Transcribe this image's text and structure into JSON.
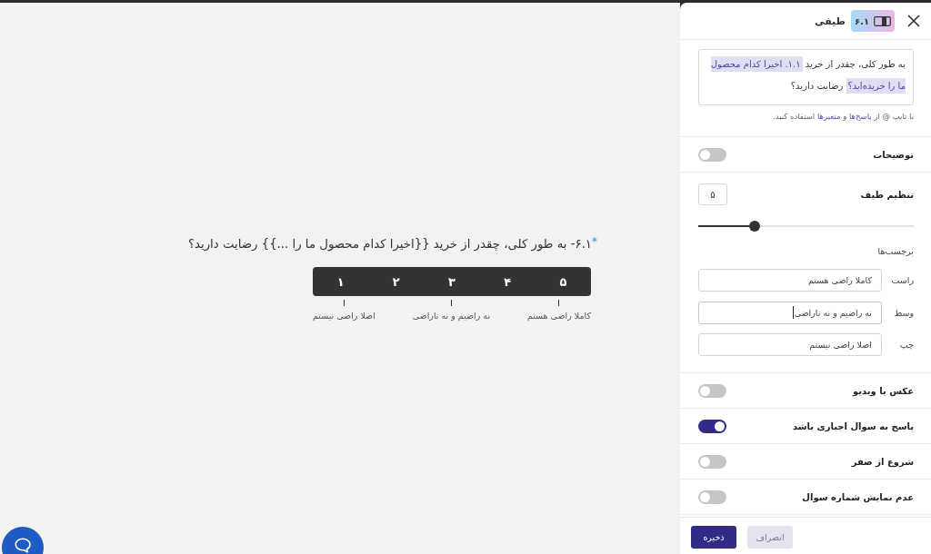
{
  "question": {
    "required_mark": "*",
    "text": "۶.۱- به طور کلی، چقدر از خرید {{اخیرا کدام محصول ما را ...}} رضایت دارید؟",
    "scale": [
      {
        "value": "۵",
        "label": "کاملا راضی هستم"
      },
      {
        "value": "۴"
      },
      {
        "value": "۳",
        "label": "نه راضیم و نه ناراضی"
      },
      {
        "value": "۲"
      },
      {
        "value": "۱",
        "label": "اصلا راضی نیستم"
      }
    ]
  },
  "panel": {
    "badge": "۶.۱",
    "title": "طیفی",
    "question_editor": {
      "segments": [
        {
          "kind": "text",
          "text": "به طور کلی، چقدر از خرید "
        },
        {
          "kind": "variable",
          "text": "۱.۱. اخیرا کدام محصول ما را خریده‌اید؟"
        },
        {
          "kind": "text",
          "text": " رضایت دارید؟"
        }
      ],
      "hint": [
        {
          "kind": "text",
          "text": "با تایپ @ از "
        },
        {
          "kind": "link",
          "text": "پاسخ‌ها"
        },
        {
          "kind": "text",
          "text": " و "
        },
        {
          "kind": "link",
          "text": "متغیرها"
        },
        {
          "kind": "text",
          "text": " استفاده کنید."
        }
      ]
    },
    "description": {
      "label": "توضیحات",
      "on": false
    },
    "range": {
      "label": "تنظیم طیف",
      "value": "۵",
      "level": 0.26
    },
    "labels": {
      "title": "برچسب‌ها",
      "fields": [
        {
          "label": "راست",
          "value": "کاملا راضی هستم",
          "focused": false
        },
        {
          "label": "وسط",
          "value": "نه راضیم و نه ناراضی",
          "focused": true
        },
        {
          "label": "چپ",
          "value": "اصلا راضی نیستم",
          "focused": false
        }
      ]
    },
    "toggles": [
      {
        "label": "عکس یا ویدیو",
        "on": false
      },
      {
        "label": "پاسخ به سوال اجباری باشد",
        "on": true
      },
      {
        "label": "شروع از صفر",
        "on": false
      },
      {
        "label": "عدم نمایش شماره سوال",
        "on": false
      }
    ],
    "buttons": [
      {
        "label": "انصراف",
        "kind": "secondary"
      },
      {
        "label": "ذخیره",
        "kind": "primary"
      }
    ]
  }
}
